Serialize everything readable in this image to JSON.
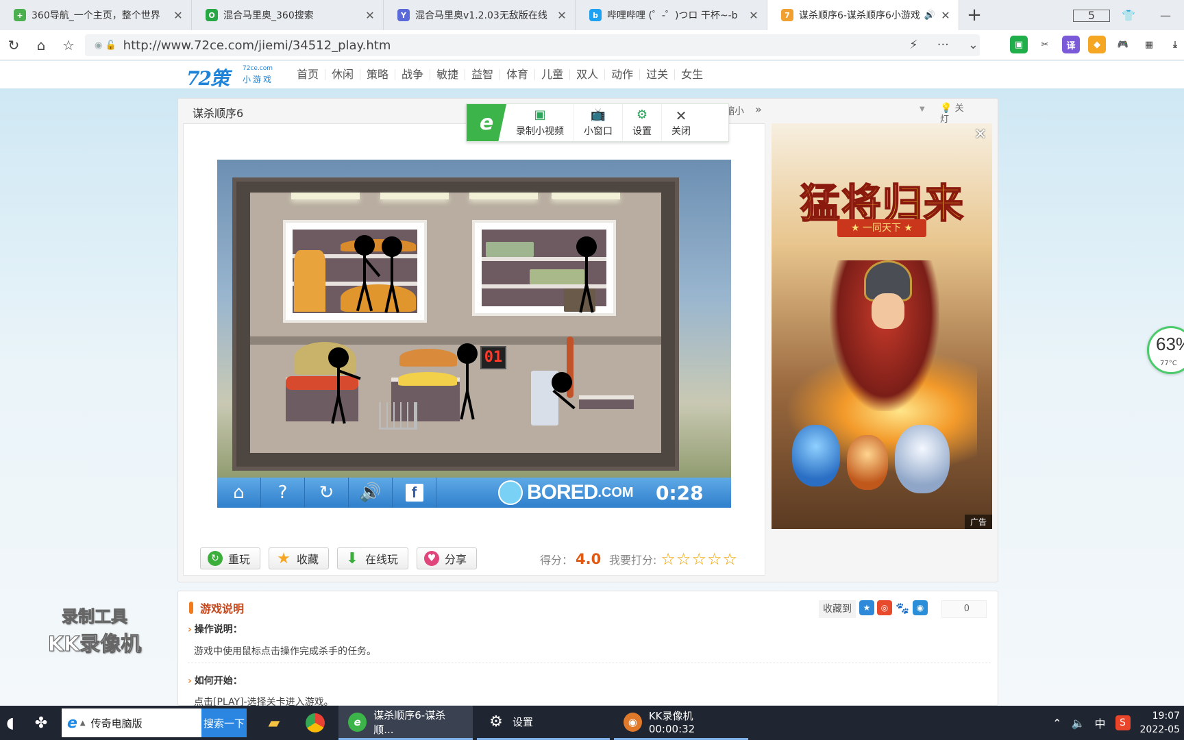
{
  "browser": {
    "tabs": [
      {
        "title": "360导航_一个主页，整个世界",
        "color": "#4caf50",
        "glyph": "+",
        "active": false
      },
      {
        "title": "混合马里奥_360搜索",
        "color": "#28a745",
        "glyph": "O",
        "active": false
      },
      {
        "title": "混合马里奥v1.2.03无敌版在线",
        "color": "#5a6ad8",
        "glyph": "Y",
        "active": false
      },
      {
        "title": "哔哩哔哩 (゜-゜)つロ 干杯~-b",
        "color": "#1da1f2",
        "glyph": "b",
        "active": false
      },
      {
        "title": "谋杀顺序6-谋杀顺序6小游戏",
        "color": "#f0a030",
        "glyph": "7",
        "active": true
      }
    ],
    "tab_count": "5",
    "url": "http://www.72ce.com/jiemi/34512_play.htm"
  },
  "site": {
    "logo_text": "72策",
    "logo_domain": "72ce.com",
    "logo_sub": "小游戏",
    "menu": [
      "首页",
      "休闲",
      "策略",
      "战争",
      "敏捷",
      "益智",
      "体育",
      "儿童",
      "双人",
      "动作",
      "过关",
      "女生"
    ]
  },
  "game": {
    "title": "谋杀顺序6",
    "right_hint": "缩小",
    "light_label": "关灯",
    "timer_display": "01",
    "brand": "BORED",
    "brand_suffix": ".COM",
    "time": "0:28"
  },
  "float_toolbar": {
    "items": [
      {
        "label": "录制小视频",
        "icon": "video-icon"
      },
      {
        "label": "小窗口",
        "icon": "tv-icon"
      },
      {
        "label": "设置",
        "icon": "gear-icon"
      },
      {
        "label": "关闭",
        "icon": "close-icon"
      }
    ]
  },
  "actions": {
    "replay": "重玩",
    "favorite": "收藏",
    "online": "在线玩",
    "share": "分享"
  },
  "rating": {
    "score_label": "得分：",
    "score_value": "4.0",
    "rate_label": "我要打分:",
    "stars": 5
  },
  "ad": {
    "title": "猛将归来",
    "subtitle": "★ 一同天下 ★",
    "label": "广告"
  },
  "description": {
    "heading": "游戏说明",
    "fav_label": "收藏到",
    "fav_count": "0",
    "sections": [
      {
        "title": "操作说明：",
        "text": "游戏中使用鼠标点击操作完成杀手的任务。"
      },
      {
        "title": "如何开始：",
        "text": "点击[PLAY]-选择关卡进入游戏。"
      }
    ]
  },
  "watermark": {
    "line1": "录制工具",
    "line2": "KK录像机"
  },
  "gauge": {
    "percent": "63%",
    "temp": "77°C"
  },
  "taskbar": {
    "search_text": "传奇电脑版",
    "search_button": "搜索一下",
    "apps": [
      {
        "label": "谋杀顺序6-谋杀顺...",
        "state": "active"
      },
      {
        "label": "设置",
        "state": "running"
      },
      {
        "label": "KK录像机 00:00:32",
        "state": "running"
      }
    ],
    "ime": "中",
    "time": "19:07",
    "date": "2022-05"
  },
  "colors": {
    "accent_blue": "#2f7fcc",
    "score_orange": "#e25a12",
    "green_brand": "#3cb44a"
  }
}
